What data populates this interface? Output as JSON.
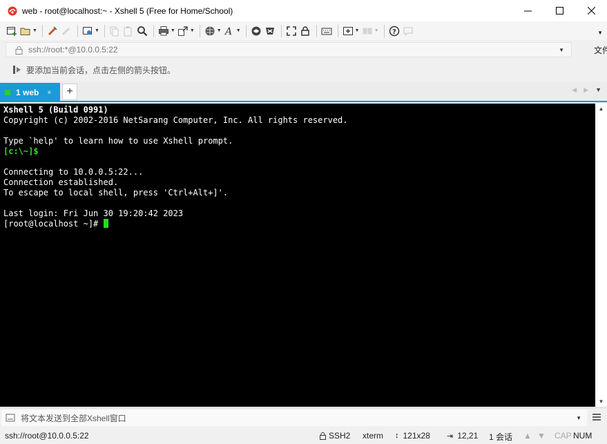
{
  "window": {
    "title": "web - root@localhost:~ - Xshell 5 (Free for Home/School)",
    "controls": {
      "minimize": "—",
      "maximize": "☐",
      "close": "✕"
    }
  },
  "toolbar": {
    "buttons": [
      {
        "icon": "new-session-icon",
        "has_dropdown": false
      },
      {
        "icon": "open-folder-icon",
        "has_dropdown": true
      },
      {
        "icon": "reconnect-icon",
        "has_dropdown": false
      },
      {
        "icon": "disconnect-icon",
        "has_dropdown": false,
        "disabled": true
      },
      {
        "icon": "properties-icon",
        "has_dropdown": true
      },
      {
        "icon": "copy-icon",
        "has_dropdown": false,
        "disabled": true
      },
      {
        "icon": "paste-icon",
        "has_dropdown": false,
        "disabled": true
      },
      {
        "icon": "find-icon",
        "has_dropdown": false
      },
      {
        "icon": "print-icon",
        "has_dropdown": true
      },
      {
        "icon": "transfer-icon",
        "has_dropdown": true
      },
      {
        "icon": "globe-icon",
        "has_dropdown": true
      },
      {
        "icon": "font-icon",
        "has_dropdown": true
      },
      {
        "icon": "xftp-icon",
        "has_dropdown": false
      },
      {
        "icon": "xmanager-icon",
        "has_dropdown": false
      },
      {
        "icon": "fullscreen-icon",
        "has_dropdown": false
      },
      {
        "icon": "lock-icon",
        "has_dropdown": false
      },
      {
        "icon": "keyboard-icon",
        "has_dropdown": false
      },
      {
        "icon": "add-pane-icon",
        "has_dropdown": true
      },
      {
        "icon": "layout-icon",
        "has_dropdown": true,
        "disabled": true
      },
      {
        "icon": "help-icon",
        "has_dropdown": false
      },
      {
        "icon": "chat-icon",
        "has_dropdown": false,
        "disabled": true
      }
    ]
  },
  "address": {
    "value": "ssh://root:*@10.0.0.5:22",
    "side_label": "文件"
  },
  "hint": {
    "text": "要添加当前会话，点击左侧的箭头按钮。"
  },
  "tabs": [
    {
      "label": "1 web",
      "active": true,
      "close": "×"
    }
  ],
  "tab_add": "+",
  "terminal": {
    "lines": [
      {
        "text": "Xshell 5 (Build 0991)",
        "style": "bold"
      },
      {
        "text": "Copyright (c) 2002-2016 NetSarang Computer, Inc. All rights reserved.",
        "style": "normal"
      },
      {
        "text": "",
        "style": "normal"
      },
      {
        "text": "Type `help' to learn how to use Xshell prompt.",
        "style": "normal"
      },
      {
        "text": "[c:\\~]$",
        "style": "green"
      },
      {
        "text": "",
        "style": "normal"
      },
      {
        "text": "Connecting to 10.0.0.5:22...",
        "style": "normal"
      },
      {
        "text": "Connection established.",
        "style": "normal"
      },
      {
        "text": "To escape to local shell, press 'Ctrl+Alt+]'.",
        "style": "normal"
      },
      {
        "text": "",
        "style": "normal"
      },
      {
        "text": "Last login: Fri Jun 30 19:20:42 2023",
        "style": "normal"
      },
      {
        "text": "[root@localhost ~]# ",
        "style": "normal",
        "cursor": true
      }
    ],
    "colors": {
      "background": "#000000",
      "foreground": "#ffffff",
      "prompt": "#28e028",
      "cursor": "#1fe01f"
    }
  },
  "send_bar": {
    "placeholder": "将文本发送到全部Xshell窗口"
  },
  "status": {
    "session": "ssh://root@10.0.0.5:22",
    "protocol": "SSH2",
    "terminal_type": "xterm",
    "size": "121x28",
    "cursor_pos": "12,21",
    "sessions": "1 会话",
    "caps": "CAP",
    "num": "NUM"
  },
  "accent_color": "#1a9ad6"
}
